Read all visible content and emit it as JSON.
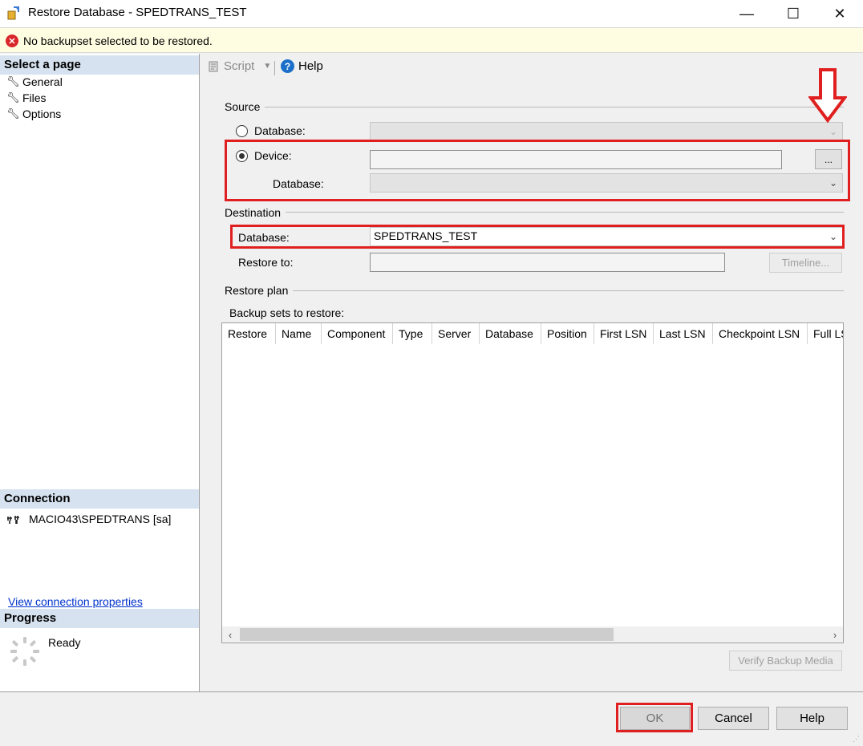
{
  "window": {
    "title": "Restore Database - SPEDTRANS_TEST",
    "minimize": "—",
    "maximize": "☐",
    "close": "✕"
  },
  "message_bar": {
    "text": "No backupset selected to be restored.",
    "icon": "error-icon"
  },
  "left_panel": {
    "select_page_header": "Select a page",
    "pages": [
      {
        "label": "General"
      },
      {
        "label": "Files"
      },
      {
        "label": "Options"
      }
    ],
    "connection_header": "Connection",
    "connection_value": "MACIO43\\SPEDTRANS [sa]",
    "view_connection_link": "View connection properties",
    "progress_header": "Progress",
    "progress_status": "Ready"
  },
  "toolbar": {
    "script_label": "Script",
    "help_label": "Help"
  },
  "source": {
    "group_label": "Source",
    "database_radio_label": "Database:",
    "device_radio_label": "Device:",
    "device_value": "",
    "browse_button": "...",
    "device_database_label": "Database:",
    "device_database_value": "",
    "selected_option": "Device"
  },
  "destination": {
    "group_label": "Destination",
    "database_label": "Database:",
    "database_value": "SPEDTRANS_TEST",
    "restore_to_label": "Restore to:",
    "restore_to_value": "",
    "timeline_button": "Timeline..."
  },
  "restore_plan": {
    "group_label": "Restore plan",
    "backup_sets_label": "Backup sets to restore:",
    "columns": [
      "Restore",
      "Name",
      "Component",
      "Type",
      "Server",
      "Database",
      "Position",
      "First LSN",
      "Last LSN",
      "Checkpoint LSN",
      "Full LS"
    ],
    "rows": [],
    "verify_button": "Verify Backup Media"
  },
  "footer": {
    "ok_button": "OK",
    "cancel_button": "Cancel",
    "help_button": "Help"
  },
  "colors": {
    "annotation_red": "#e02020",
    "panel_header": "#d6e2ef",
    "message_bar_bg": "#fffde1"
  }
}
